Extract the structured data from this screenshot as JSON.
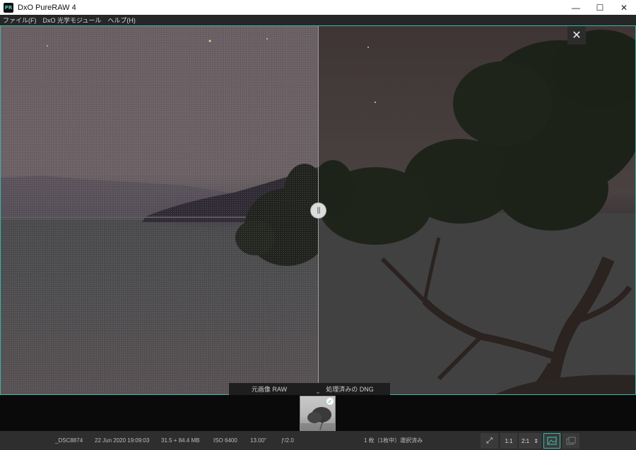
{
  "window": {
    "app_logo": "PR",
    "title": "DxO PureRAW 4",
    "controls": {
      "minimize": "—",
      "maximize": "☐",
      "close": "✕"
    }
  },
  "menu": {
    "items": [
      "ファイル(F)",
      "DxO 光学モジュール",
      "ヘルプ(H)"
    ]
  },
  "viewer": {
    "close_glyph": "✕",
    "divider_glyph": "|||",
    "label_original": "元画像 RAW",
    "label_processed": "処理済みの DNG",
    "chevron_glyph": "⌄"
  },
  "filmstrip": {
    "check_glyph": "✓"
  },
  "status": {
    "filename": "_DSC8874",
    "datetime": "22 Jun 2020 19:09:03",
    "filesize": "31.5 + 84.4 MB",
    "iso": "ISO 6400",
    "shutter": "13.00\"",
    "aperture": "ƒ/2.0",
    "selection": "1 枚（1枚中）選択済み",
    "zoom_fit_icon": "⤢",
    "zoom_1_1": "1:1",
    "zoom_select": "2:1",
    "zoom_select_arrows": "⇕"
  },
  "colors": {
    "accent": "#39b7a6",
    "titlebar_bg": "#ffffff",
    "menubar_bg": "#262626",
    "filmstrip_bg": "#0a0a0a",
    "statusbar_bg": "#2e2e2e"
  },
  "icons": {
    "app": "dxo-pureraw-logo",
    "close": "close-icon",
    "fit": "fit-screen-icon",
    "view_single": "single-image-view-icon",
    "view_compare": "compare-view-icon"
  }
}
